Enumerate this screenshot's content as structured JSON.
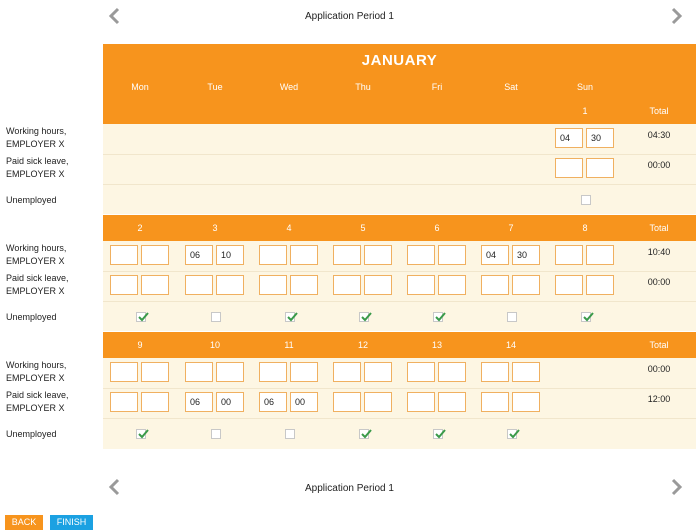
{
  "header": {
    "title": "Application Period 1",
    "prev_icon": "chevron-left-icon",
    "next_icon": "chevron-right-icon"
  },
  "footer_nav": {
    "title": "Application Period 1",
    "prev_icon": "chevron-left-icon",
    "next_icon": "chevron-right-icon"
  },
  "calendar": {
    "month": "JANUARY",
    "weekdays": [
      "Mon",
      "Tue",
      "Wed",
      "Thu",
      "Fri",
      "Sat",
      "Sun"
    ],
    "total_label": "Total",
    "row_labels": {
      "working": [
        "Working hours,",
        "EMPLOYER X"
      ],
      "sick": [
        "Paid sick leave,",
        "EMPLOYER X"
      ],
      "unemployed": "Unemployed"
    },
    "weeks": [
      {
        "dates": [
          "",
          "",
          "",
          "",
          "",
          "",
          "1"
        ],
        "working": [
          null,
          null,
          null,
          null,
          null,
          null,
          [
            "04",
            "30"
          ]
        ],
        "sick": [
          null,
          null,
          null,
          null,
          null,
          null,
          [
            "",
            ""
          ]
        ],
        "unemployed": [
          null,
          null,
          null,
          null,
          null,
          null,
          false
        ],
        "total_working": "04:30",
        "total_sick": "00:00"
      },
      {
        "dates": [
          "2",
          "3",
          "4",
          "5",
          "6",
          "7",
          "8"
        ],
        "working": [
          [
            "",
            ""
          ],
          [
            "06",
            "10"
          ],
          [
            "",
            ""
          ],
          [
            "",
            ""
          ],
          [
            "",
            ""
          ],
          [
            "04",
            "30"
          ],
          [
            "",
            ""
          ]
        ],
        "sick": [
          [
            "",
            ""
          ],
          [
            "",
            ""
          ],
          [
            "",
            ""
          ],
          [
            "",
            ""
          ],
          [
            "",
            ""
          ],
          [
            "",
            ""
          ],
          [
            "",
            ""
          ]
        ],
        "unemployed": [
          true,
          false,
          true,
          true,
          true,
          false,
          true
        ],
        "total_working": "10:40",
        "total_sick": "00:00"
      },
      {
        "dates": [
          "9",
          "10",
          "11",
          "12",
          "13",
          "14",
          ""
        ],
        "working": [
          [
            "",
            ""
          ],
          [
            "",
            ""
          ],
          [
            "",
            ""
          ],
          [
            "",
            ""
          ],
          [
            "",
            ""
          ],
          [
            "",
            ""
          ],
          null
        ],
        "sick": [
          [
            "",
            ""
          ],
          [
            "06",
            "00"
          ],
          [
            "06",
            "00"
          ],
          [
            "",
            ""
          ],
          [
            "",
            ""
          ],
          [
            "",
            ""
          ],
          null
        ],
        "unemployed": [
          true,
          false,
          false,
          true,
          true,
          true,
          null
        ],
        "total_working": "00:00",
        "total_sick": "12:00"
      }
    ]
  },
  "buttons": {
    "back": "BACK",
    "finish": "FINISH"
  },
  "colors": {
    "accent": "#f7941d",
    "row_background": "#fdf6e3",
    "input_border": "#f0b060",
    "check": "#3a9a4a",
    "back_button": "#f7941d",
    "finish_button": "#1ba1e2"
  }
}
